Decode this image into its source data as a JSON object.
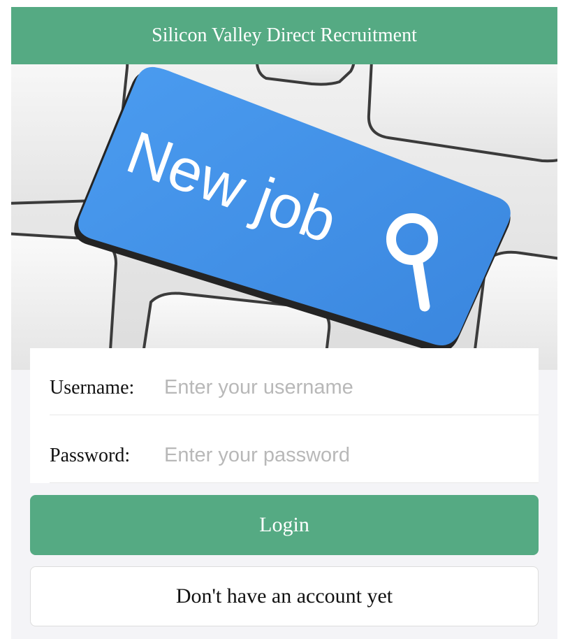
{
  "header": {
    "title": "Silicon Valley Direct Recruitment"
  },
  "hero": {
    "key_text": "New job",
    "icon": "magnifier-icon",
    "key_color": "#3d8fe6"
  },
  "form": {
    "username_label": "Username:",
    "username_placeholder": "Enter your username",
    "username_value": "",
    "password_label": "Password:",
    "password_placeholder": "Enter your password",
    "password_value": ""
  },
  "actions": {
    "login_label": "Login",
    "register_label": "Don't have an account yet"
  },
  "colors": {
    "brand": "#55aa83",
    "background": "#f4f4f7",
    "placeholder": "#b8b8b8"
  }
}
